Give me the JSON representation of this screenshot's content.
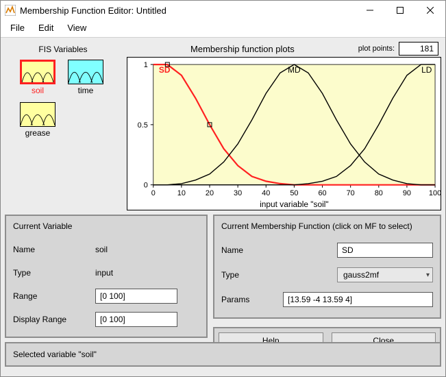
{
  "window": {
    "title": "Membership Function Editor: Untitled"
  },
  "menu": {
    "file": "File",
    "edit": "Edit",
    "view": "View"
  },
  "fis": {
    "title": "FIS Variables",
    "vars": [
      {
        "name": "soil",
        "selected": true,
        "kind": "input"
      },
      {
        "name": "time",
        "selected": false,
        "kind": "output"
      },
      {
        "name": "grease",
        "selected": false,
        "kind": "input"
      }
    ]
  },
  "plot": {
    "title": "Membership function plots",
    "plot_points_label": "plot points:",
    "plot_points": "181",
    "xlabel": "input variable \"soil\"",
    "mf_labels": {
      "sd": "SD",
      "md": "MD",
      "ld": "LD"
    },
    "xlim": [
      0,
      100
    ],
    "ylim": [
      0,
      1
    ],
    "xticks": [
      0,
      10,
      20,
      30,
      40,
      50,
      60,
      70,
      80,
      90,
      100
    ],
    "yticks": [
      0,
      0.5,
      1
    ]
  },
  "chart_data": {
    "type": "line",
    "title": "Membership function plots",
    "xlabel": "input variable \"soil\"",
    "ylabel": "",
    "xlim": [
      0,
      100
    ],
    "ylim": [
      0,
      1
    ],
    "x": [
      0,
      5,
      10,
      15,
      20,
      25,
      30,
      35,
      40,
      45,
      50,
      55,
      60,
      65,
      70,
      75,
      80,
      85,
      90,
      95,
      100
    ],
    "series": [
      {
        "name": "SD",
        "selected": true,
        "type": "gauss2mf",
        "params": [
          13.59,
          -4,
          13.59,
          4
        ],
        "values": [
          1.0,
          1.0,
          0.91,
          0.72,
          0.5,
          0.3,
          0.16,
          0.07,
          0.03,
          0.01,
          0.0,
          0.0,
          0.0,
          0.0,
          0.0,
          0.0,
          0.0,
          0.0,
          0.0,
          0.0,
          0.0
        ]
      },
      {
        "name": "MD",
        "selected": false,
        "type": "gauss2mf",
        "values": [
          0.0,
          0.0,
          0.01,
          0.04,
          0.09,
          0.19,
          0.34,
          0.54,
          0.76,
          0.93,
          1.0,
          0.93,
          0.76,
          0.54,
          0.34,
          0.19,
          0.09,
          0.04,
          0.01,
          0.0,
          0.0
        ]
      },
      {
        "name": "LD",
        "selected": false,
        "type": "gauss2mf",
        "values": [
          0.0,
          0.0,
          0.0,
          0.0,
          0.0,
          0.0,
          0.0,
          0.0,
          0.0,
          0.0,
          0.0,
          0.01,
          0.03,
          0.07,
          0.16,
          0.3,
          0.5,
          0.72,
          0.91,
          1.0,
          1.0
        ]
      }
    ]
  },
  "current_var": {
    "panel_title": "Current Variable",
    "name_lbl": "Name",
    "name": "soil",
    "type_lbl": "Type",
    "type": "input",
    "range_lbl": "Range",
    "range": "[0 100]",
    "drange_lbl": "Display Range",
    "drange": "[0 100]"
  },
  "current_mf": {
    "panel_title": "Current Membership Function (click on MF to select)",
    "name_lbl": "Name",
    "name": "SD",
    "type_lbl": "Type",
    "type": "gauss2mf",
    "params_lbl": "Params",
    "params": "[13.59 -4 13.59 4]"
  },
  "buttons": {
    "help": "Help",
    "close": "Close"
  },
  "status": "Selected variable \"soil\""
}
